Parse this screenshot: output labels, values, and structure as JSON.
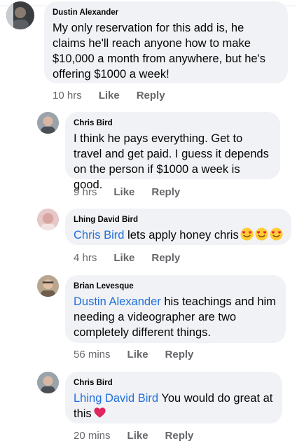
{
  "comments": [
    {
      "author": "Dustin Alexander",
      "mention": "",
      "text": "My only reservation for this add is, he claims he'll reach anyone how to make $10,000 a month from anywhere, but he's offering $1000 a week!",
      "time": "10 hrs",
      "like": "Like",
      "reply": "Reply",
      "avatar": "avatar-photo-dark"
    },
    {
      "author": "Chris Bird",
      "mention": "",
      "text": "I think he pays everything. Get to travel and get paid. I guess it depends on the person if $1000 a week is good.",
      "time": "9 hrs",
      "like": "Like",
      "reply": "Reply",
      "avatar": "avatar-photo-grey"
    },
    {
      "author": "Lhing David Bird",
      "mention": "Chris Bird",
      "text": " lets apply honey chris",
      "emojis": [
        "heart-eyes-emoji",
        "heart-eyes-emoji",
        "heart-eyes-emoji"
      ],
      "time": "4 hrs",
      "like": "Like",
      "reply": "Reply",
      "avatar": "avatar-photo-pink"
    },
    {
      "author": "Brian Levesque",
      "mention": "Dustin Alexander",
      "text": " his teachings and him needing a videographer are two completely different things.",
      "time": "56 mins",
      "like": "Like",
      "reply": "Reply",
      "avatar": "avatar-photo-tan"
    },
    {
      "author": "Chris Bird",
      "mention": "Lhing David Bird",
      "text": " You would do great at this",
      "emojis": [
        "red-heart-emoji"
      ],
      "time": "20 mins",
      "like": "Like",
      "reply": "Reply",
      "avatar": "avatar-photo-grey"
    }
  ],
  "colors": {
    "bubble": "#f0f2f5",
    "mention": "#216fdb",
    "meta": "#65676b",
    "text": "#050505"
  }
}
